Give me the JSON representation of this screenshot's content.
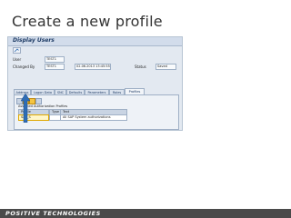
{
  "slide": {
    "title": "Create a new profile",
    "footer": "POSITIVE TECHNOLOGIES"
  },
  "window": {
    "title": "Display Users"
  },
  "user": {
    "user_label": "User",
    "user_value": "TEST1",
    "changed_label": "Changed By",
    "changed_value": "TEST1",
    "date_value": "02.06.2013 13:45:55",
    "status_label": "Status",
    "status_value": "Saved"
  },
  "tabs": [
    "Address",
    "Logon Data",
    "SNC",
    "Defaults",
    "Parameters",
    "Roles",
    "Profiles"
  ],
  "active_tab": "Profiles",
  "profiles_panel": {
    "assign_label": "Assigned Authorization Profiles",
    "col_profile": "Profile",
    "col_type": "Type",
    "col_text": "Text",
    "rows": [
      {
        "profile": "SAP_S",
        "text": "All SAP System authorizations"
      }
    ]
  },
  "colors": {
    "highlight": "#f4c542",
    "arrow": "#2f6db5",
    "footer_bg": "#4a4a4a"
  },
  "icons": [
    "window-title-icon",
    "toolbar-display-icon",
    "profile-add-icon",
    "profile-delete-icon",
    "profile-filter-icon",
    "profile-refresh-icon",
    "blue-arrow-icon"
  ]
}
